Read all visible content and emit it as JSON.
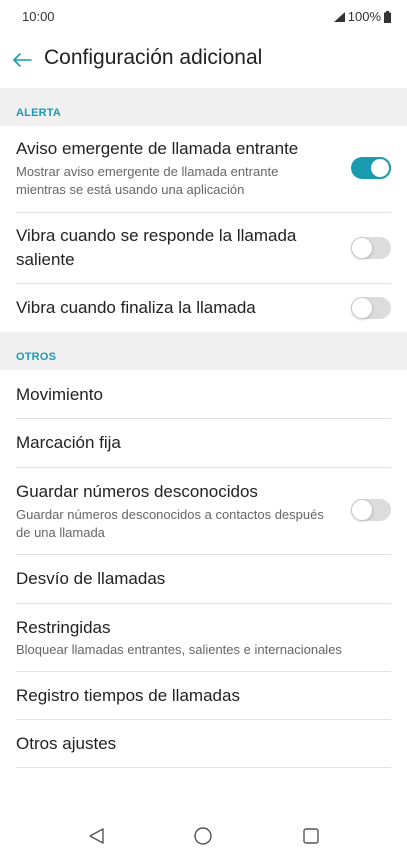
{
  "status_bar": {
    "time": "10:00",
    "battery": "100%"
  },
  "header": {
    "title": "Configuración adicional"
  },
  "sections": {
    "alerta": {
      "title": "ALERTA",
      "items": [
        {
          "title": "Aviso emergente de llamada entrante",
          "subtitle": "Mostrar aviso emergente de llamada entrante mientras se está usando una aplicación",
          "toggle": "on"
        },
        {
          "title": "Vibra cuando se responde la llamada saliente",
          "toggle": "off"
        },
        {
          "title": "Vibra cuando finaliza la llamada",
          "toggle": "off"
        }
      ]
    },
    "otros": {
      "title": "OTROS",
      "items": [
        {
          "title": "Movimiento"
        },
        {
          "title": "Marcación fija"
        },
        {
          "title": "Guardar números desconocidos",
          "subtitle": "Guardar números desconocidos a contactos después de una llamada",
          "toggle": "off"
        },
        {
          "title": "Desvío de llamadas"
        },
        {
          "title": "Restringidas",
          "subtitle": "Bloquear llamadas entrantes, salientes e internacionales"
        },
        {
          "title": "Registro tiempos de llamadas"
        },
        {
          "title": "Otros ajustes"
        }
      ]
    }
  },
  "icons": {
    "back": "arrow-left-icon",
    "nav_back": "triangle-back-icon",
    "nav_home": "circle-home-icon",
    "nav_recents": "square-recents-icon"
  },
  "colors": {
    "accent": "#1a9bb0",
    "section_bg": "#f0f0f0",
    "toggle_off": "#dcdcdc"
  }
}
